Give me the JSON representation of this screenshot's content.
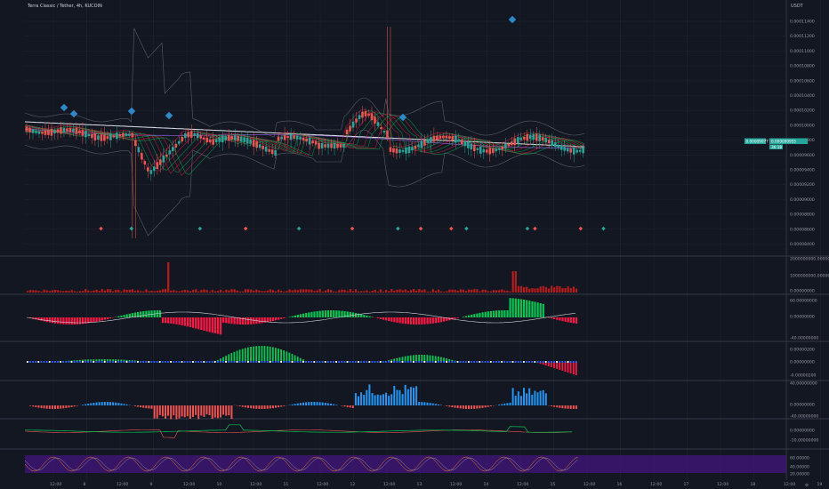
{
  "header": {
    "symbol_title": "Terra Classic / Tether, 4h, KUCOIN",
    "currency": "USDT"
  },
  "price_badges": {
    "current_price": "0.000090955",
    "countdown": "36:18",
    "left_value": "0.00009077"
  },
  "colors": {
    "background": "#131722",
    "up": "#26a69a",
    "down": "#ef5350",
    "bright_up": "#00c853",
    "bright_down": "#ff1744",
    "volume": "#b71c1c",
    "macd_blue": "#2196f3",
    "rsi_band": "#4a148c",
    "signal_blue": "#2a89c6",
    "white_line": "#e0e3eb"
  },
  "chart_data": [
    {
      "type": "candlestick",
      "panel": "price",
      "ylim": [
        3.5e-06,
        0.000114
      ],
      "y_ticks": [
        "0.00011400",
        "0.00011200",
        "0.00011000",
        "0.00010800",
        "0.00010600",
        "0.00010400",
        "0.00010200",
        "0.00010000",
        "0.00009800",
        "0.00009600",
        "0.00009400",
        "0.00009200",
        "0.00009000",
        "0.00008800",
        "0.00008600",
        "0.00008400"
      ],
      "x_ticks": [
        "12:00",
        "8",
        "12:00",
        "9",
        "12:00",
        "10",
        "12:00",
        "11",
        "12:00",
        "12",
        "12:00",
        "13",
        "12:00",
        "14",
        "12:00",
        "15",
        "12:00",
        "16",
        "12:00",
        "17",
        "12:00",
        "18",
        "12:00",
        "19"
      ],
      "signals_up": [
        0.14,
        0.23,
        0.36,
        0.49,
        0.58,
        0.66,
        0.76
      ],
      "signals_down": [
        0.1,
        0.29,
        0.43,
        0.52,
        0.56,
        0.67,
        0.73
      ]
    },
    {
      "type": "bar",
      "panel": "volume",
      "y_ticks": [
        "2000000000.00000000",
        "1000000000.00000000",
        "0.00000000"
      ]
    },
    {
      "type": "bar",
      "panel": "oscillator-1",
      "y_ticks": [
        "60.00000000",
        "0.00000000",
        "-40.00000000"
      ]
    },
    {
      "type": "bar",
      "panel": "momentum",
      "y_ticks": [
        "0.00000200",
        "0.00000000",
        "-0.00000200"
      ]
    },
    {
      "type": "bar",
      "panel": "macd",
      "y_ticks": [
        "40.00000000",
        "0.00000000",
        "-40.00000000"
      ]
    },
    {
      "type": "line",
      "panel": "oscillator-2",
      "y_ticks": [
        "0.00000000",
        "-10.00000000"
      ]
    },
    {
      "type": "line",
      "panel": "rsi",
      "y_ticks": [
        "60.00000",
        "40.00000",
        "20.00000"
      ]
    }
  ]
}
